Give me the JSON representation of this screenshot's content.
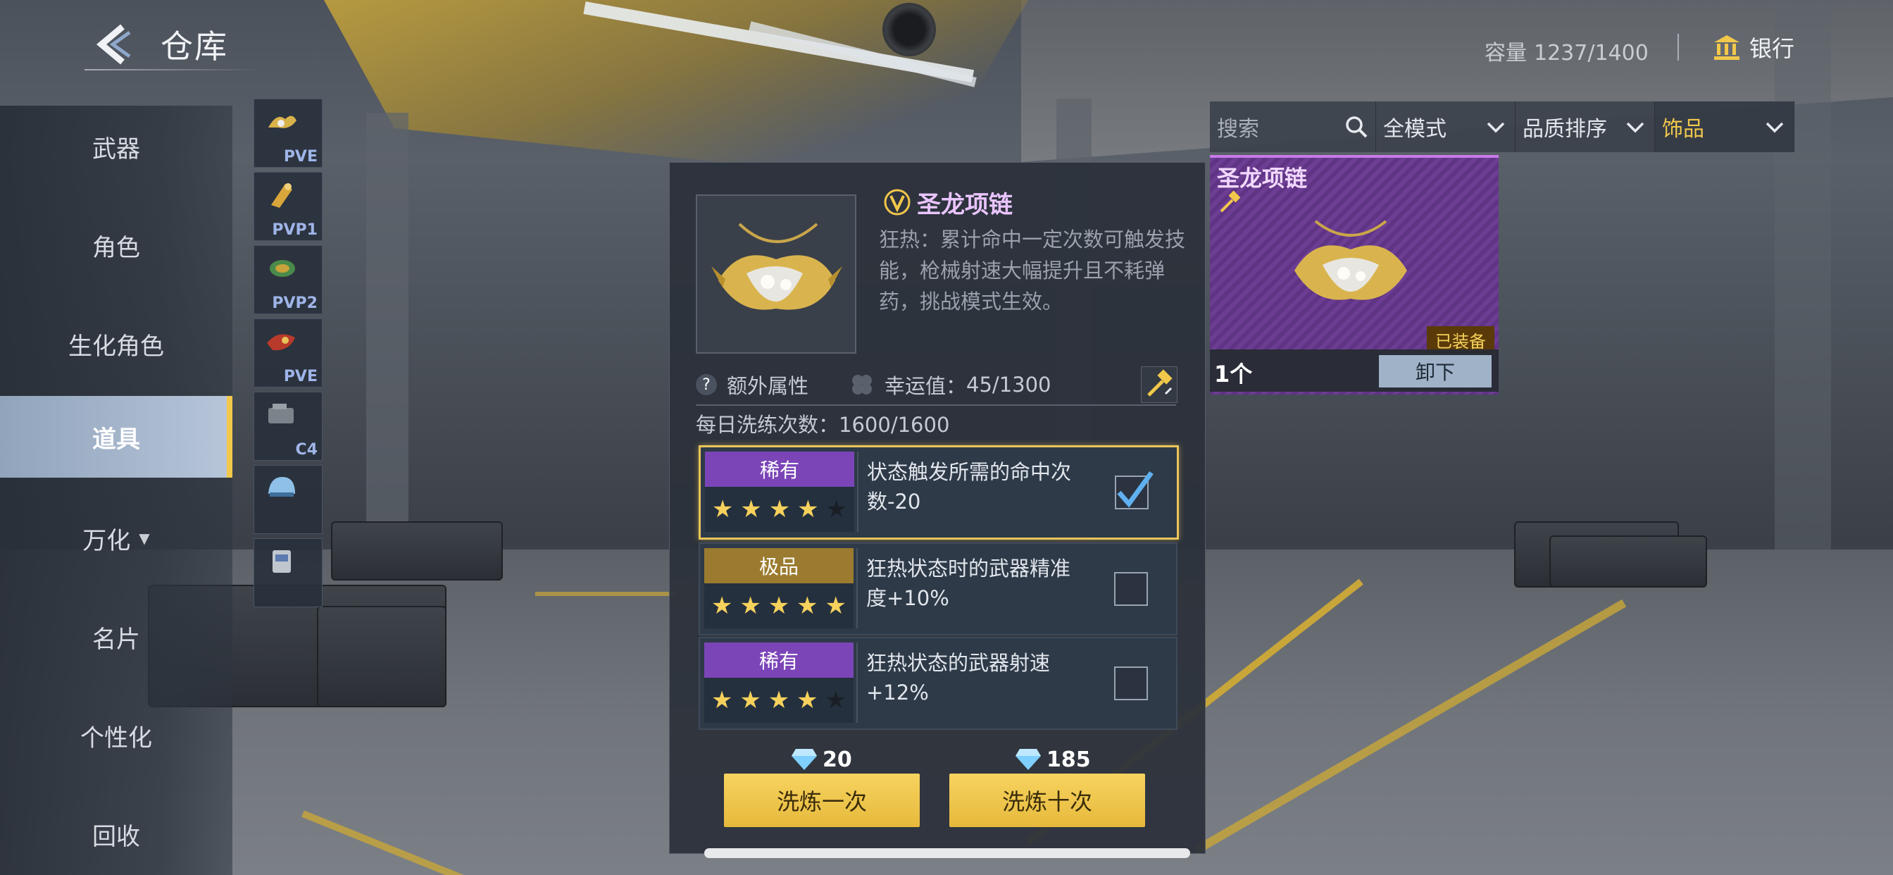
{
  "header": {
    "title": "仓库",
    "capacity_label": "容量",
    "capacity_value": "1237/1400",
    "bank_label": "银行"
  },
  "nav": {
    "items": [
      {
        "label": "武器"
      },
      {
        "label": "角色"
      },
      {
        "label": "生化角色"
      },
      {
        "label": "道具"
      },
      {
        "label": "万化"
      },
      {
        "label": "名片"
      },
      {
        "label": "个性化"
      },
      {
        "label": "回收"
      }
    ],
    "active_index": 3
  },
  "thumbs": [
    {
      "tag": "PVE",
      "icon": "charm-icon"
    },
    {
      "tag": "PVP1",
      "icon": "charm-icon"
    },
    {
      "tag": "PVP2",
      "icon": "charm-icon"
    },
    {
      "tag": "PVE",
      "icon": "charm-icon"
    },
    {
      "tag": "C4",
      "icon": "c4-icon"
    },
    {
      "tag": "",
      "icon": "helmet-icon"
    },
    {
      "tag": "",
      "icon": "device-icon"
    }
  ],
  "detail": {
    "name": "圣龙项链",
    "description": "狂热：累计命中一定次数可触发技能，枪械射速大幅提升且不耗弹药，挑战模式生效。",
    "extra_attr_label": "额外属性",
    "luck_label": "幸运值：",
    "luck_value": "45/1300",
    "daily_label": "每日洗练次数：",
    "daily_value": "1600/1600",
    "options": [
      {
        "rarity": "稀有",
        "rarity_color": "#7b45b8",
        "stars_on": 4,
        "text": "状态触发所需的命中次数-20",
        "checked": true
      },
      {
        "rarity": "极品",
        "rarity_color": "#9b7b2f",
        "stars_on": 5,
        "text": "狂热状态时的武器精准度+10%",
        "checked": false
      },
      {
        "rarity": "稀有",
        "rarity_color": "#7b45b8",
        "stars_on": 4,
        "text": "狂热状态的武器射速+12%",
        "checked": false
      }
    ],
    "cost_once": "20",
    "cost_ten": "185",
    "btn_once": "洗炼一次",
    "btn_ten": "洗炼十次"
  },
  "filters": {
    "search_placeholder": "搜索",
    "mode": "全模式",
    "sort": "品质排序",
    "category": "饰品"
  },
  "preview": {
    "name": "圣龙项链",
    "equipped": "已装备",
    "qty": "1个",
    "unequip": "卸下"
  },
  "colors": {
    "accent_gold": "#f2c84b",
    "rare_purple": "#7b45b8",
    "epic_gold": "#9b7b2f"
  }
}
